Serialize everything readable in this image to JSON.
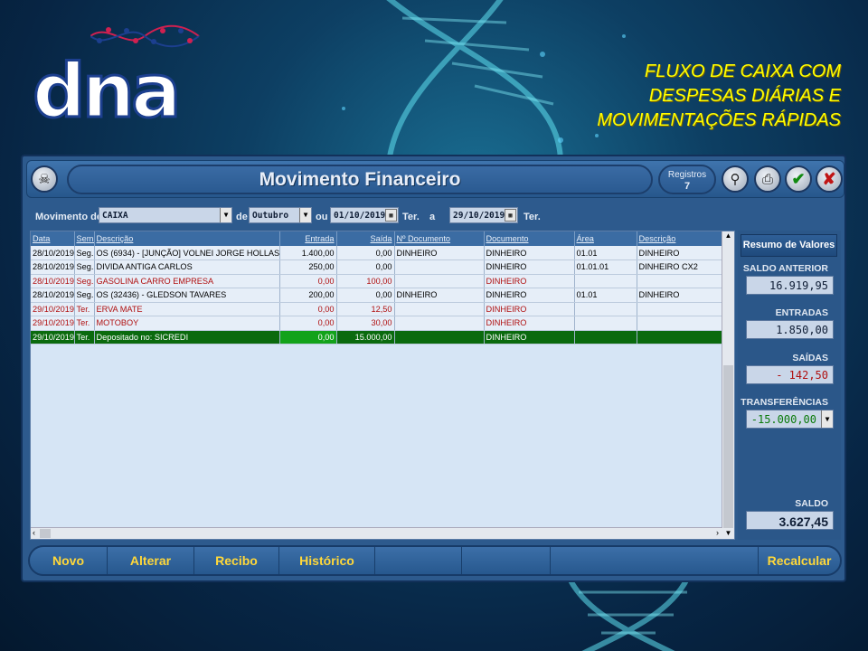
{
  "brand": {
    "logo_text": "dna"
  },
  "tagline": [
    "FLUXO DE CAIXA COM",
    "DESPESAS DIÁRIAS E",
    "MOVIMENTAÇÕES RÁPIDAS"
  ],
  "window": {
    "title": "Movimento Financeiro",
    "registros_label": "Registros",
    "registros_value": "7"
  },
  "filter": {
    "movimento_label": "Movimento de:",
    "movimento_value": "CAIXA",
    "de_label": "de",
    "mes_value": "Outubro",
    "ou_label": "ou",
    "date_from": "01/10/2019",
    "day_from": "Ter.",
    "a_label": "a",
    "date_to": "29/10/2019",
    "day_to": "Ter."
  },
  "grid": {
    "columns": [
      "Data",
      "Sem.",
      "Descrição",
      "Entrada",
      "Saída",
      "Nº Documento",
      "Documento",
      "Área",
      "Descrição"
    ],
    "rows": [
      {
        "style": "normal",
        "cells": [
          "28/10/2019",
          "Seg.",
          "OS (6934) - [JUNÇÃO] VOLNEI JORGE HOLLAS",
          "1.400,00",
          "0,00",
          "DINHEIRO",
          "DINHEIRO",
          "01.01",
          "DINHEIRO"
        ]
      },
      {
        "style": "normal",
        "cells": [
          "28/10/2019",
          "Seg.",
          "DIVIDA ANTIGA CARLOS",
          "250,00",
          "0,00",
          "",
          "DINHEIRO",
          "01.01.01",
          "DINHEIRO CX2"
        ]
      },
      {
        "style": "red",
        "cells": [
          "28/10/2019",
          "Seg.",
          "GASOLINA CARRO EMPRESA",
          "0,00",
          "100,00",
          "",
          "DINHEIRO",
          "",
          ""
        ]
      },
      {
        "style": "normal",
        "cells": [
          "28/10/2019",
          "Seg.",
          "OS (32436) - GLEDSON TAVARES",
          "200,00",
          "0,00",
          "DINHEIRO",
          "DINHEIRO",
          "01.01",
          "DINHEIRO"
        ]
      },
      {
        "style": "red",
        "cells": [
          "29/10/2019",
          "Ter.",
          "ERVA MATE",
          "0,00",
          "12,50",
          "",
          "DINHEIRO",
          "",
          ""
        ]
      },
      {
        "style": "red",
        "cells": [
          "29/10/2019",
          "Ter.",
          "MOTOBOY",
          "0,00",
          "30,00",
          "",
          "DINHEIRO",
          "",
          ""
        ]
      },
      {
        "style": "sel",
        "cells": [
          "29/10/2019",
          "Ter.",
          "Depositado no: SICREDI",
          "0,00",
          "15.000,00",
          "",
          "DINHEIRO",
          "",
          ""
        ]
      }
    ]
  },
  "summary": {
    "head": "Resumo de Valores",
    "saldo_anterior_label": "SALDO ANTERIOR",
    "saldo_anterior": "16.919,95",
    "entradas_label": "ENTRADAS",
    "entradas": "1.850,00",
    "saidas_label": "SAÍDAS",
    "saidas": "- 142,50",
    "transf_label": "TRANSFERÊNCIAS",
    "transf": "-15.000,00",
    "saldo_label": "SALDO",
    "saldo": "3.627,45"
  },
  "buttons": {
    "novo": "Novo",
    "alterar": "Alterar",
    "recibo": "Recibo",
    "historico": "Histórico",
    "recalcular": "Recalcular"
  },
  "colors": {
    "accent": "#ffd83a",
    "selected_row": "#0a6a0e",
    "expense_text": "#b01010",
    "saidas_value": "#b01010",
    "transf_value": "#0a7a0a"
  }
}
